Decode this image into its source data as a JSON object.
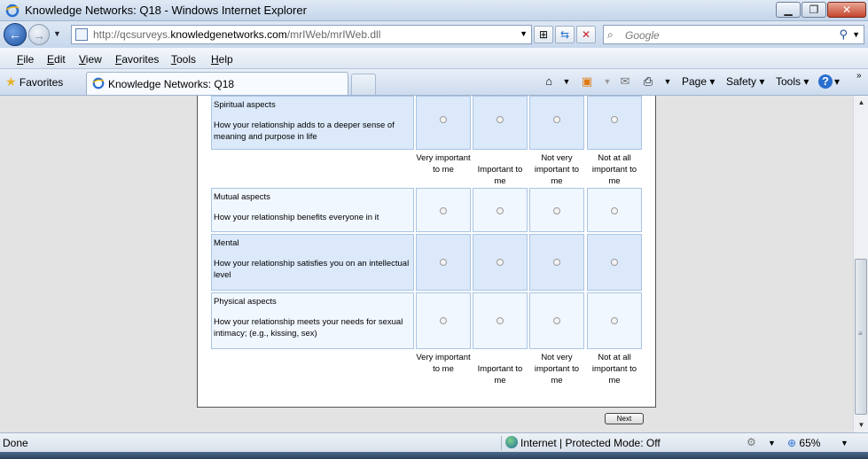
{
  "window": {
    "title": "Knowledge Networks: Q18 - Windows Internet Explorer",
    "minimize_glyph": "▁",
    "restore_glyph": "❐",
    "close_glyph": "✕"
  },
  "nav": {
    "back_glyph": "←",
    "forward_glyph": "→",
    "url_prefix": "http://qcsurveys.",
    "url_domain": "knowledgenetworks.com",
    "url_path": "/mrIWeb/mrIWeb.dll",
    "search_placeholder": "Google"
  },
  "menu": {
    "items": [
      {
        "label": "File",
        "key": "F",
        "rest": "ile"
      },
      {
        "label": "Edit",
        "key": "E",
        "rest": "dit"
      },
      {
        "label": "View",
        "key": "V",
        "rest": "iew"
      },
      {
        "label": "Favorites",
        "key": "F",
        "rest": "avorites"
      },
      {
        "label": "Tools",
        "key": "T",
        "rest": "ools"
      },
      {
        "label": "Help",
        "key": "H",
        "rest": "elp"
      }
    ]
  },
  "favorites_bar": {
    "favorites_label": "Favorites",
    "tab_label": "Knowledge Networks: Q18",
    "commands": {
      "page": "Page ▾",
      "safety": "Safety ▾",
      "tools": "Tools ▾",
      "help": "▾"
    }
  },
  "survey": {
    "rows": [
      {
        "aspect": "Spiritual aspects",
        "description": "How your relationship adds to a deeper sense of meaning and purpose in life"
      },
      {
        "aspect": "Mutual aspects",
        "description": "How your relationship benefits everyone in it"
      },
      {
        "aspect": "Mental",
        "description": "How your relationship satisfies you on an intellectual level"
      },
      {
        "aspect": "Physical aspects",
        "description": "How your relationship meets your needs for sexual intimacy; (e.g., kissing, sex)"
      }
    ],
    "columns": [
      "Very important to me",
      "Important to me",
      "Not very important to me",
      "Not at all important to me"
    ],
    "next_label": "Next"
  },
  "status": {
    "text": "Done",
    "zone": "Internet | Protected Mode: Off",
    "zoom": "65%"
  }
}
